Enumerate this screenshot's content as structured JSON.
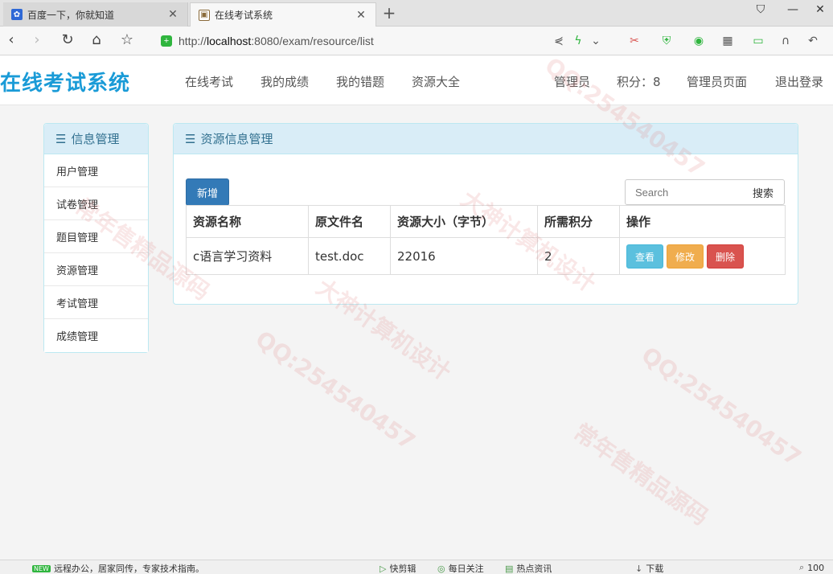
{
  "browser": {
    "tabs": [
      {
        "title": "百度一下，你就知道",
        "icon": "baidu-paw-icon",
        "active": false
      },
      {
        "title": "在线考试系统",
        "icon": "image-favicon-icon",
        "active": true
      }
    ],
    "url_prefix": "http://",
    "url_host": "localhost",
    "url_rest": ":8080/exam/resource/list",
    "colors": {
      "secure": "#2fb53e"
    }
  },
  "site": {
    "brand": "在线考试系统",
    "nav": [
      "在线考试",
      "我的成绩",
      "我的错题",
      "资源大全"
    ],
    "user": {
      "role": "管理员",
      "points": "积分：8",
      "admin_page": "管理员页面",
      "logout": "退出登录"
    },
    "colors": {
      "brand": "#1a9bd7"
    }
  },
  "sidebar": {
    "title": "信息管理",
    "items": [
      "用户管理",
      "试卷管理",
      "题目管理",
      "资源管理",
      "考试管理",
      "成绩管理"
    ]
  },
  "main": {
    "title": "资源信息管理",
    "add_label": "新增",
    "search": {
      "placeholder": "Search",
      "button": "搜索"
    },
    "table": {
      "headers": [
        "资源名称",
        "原文件名",
        "资源大小（字节）",
        "所需积分",
        "操作"
      ],
      "rows": [
        {
          "name": "c语言学习资料",
          "file": "test.doc",
          "size": "22016",
          "points": "2",
          "actions": [
            "查看",
            "修改",
            "删除"
          ]
        }
      ]
    }
  },
  "watermarks": [
    "QQ:254540457",
    "大神计算机设计",
    "常年售精品源码"
  ],
  "statusbar": {
    "left": "远程办公，居家同传，专家技术指南。",
    "items": [
      "快剪辑",
      "每日关注",
      "热点资讯",
      "下载"
    ],
    "zoom": "100"
  }
}
